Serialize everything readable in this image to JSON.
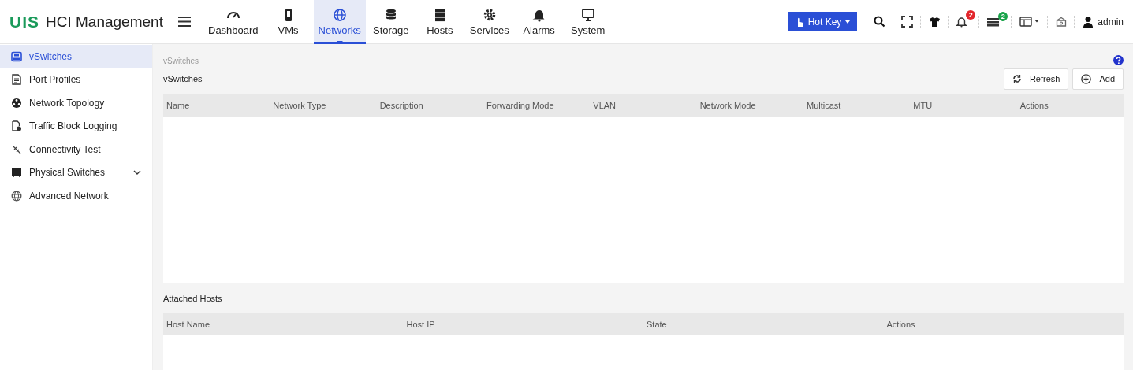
{
  "brand": {
    "logo": "UIS",
    "title": "HCI Management"
  },
  "nav": [
    {
      "label": "Dashboard",
      "selected": false
    },
    {
      "label": "VMs",
      "selected": false
    },
    {
      "label": "Networks",
      "selected": true
    },
    {
      "label": "Storage",
      "selected": false
    },
    {
      "label": "Hosts",
      "selected": false
    },
    {
      "label": "Services",
      "selected": false
    },
    {
      "label": "Alarms",
      "selected": false
    },
    {
      "label": "System",
      "selected": false
    }
  ],
  "hotkey": "Hot Key",
  "alarm_badge": "2",
  "task_badge": "2",
  "user": "admin",
  "sidebar": [
    {
      "label": "vSwitches",
      "selected": true
    },
    {
      "label": "Port Profiles",
      "selected": false
    },
    {
      "label": "Network Topology",
      "selected": false
    },
    {
      "label": "Traffic Block Logging",
      "selected": false
    },
    {
      "label": "Connectivity Test",
      "selected": false
    },
    {
      "label": "Physical Switches",
      "selected": false,
      "expanded": false
    },
    {
      "label": "Advanced Network",
      "selected": false
    }
  ],
  "breadcrumb": "vSwitches",
  "section_title": "vSwitches",
  "buttons": [
    "Refresh",
    "Add"
  ],
  "vswitch_table": {
    "columns": [
      "Name",
      "Network Type",
      "Description",
      "Forwarding Mode",
      "VLAN",
      "Network Mode",
      "Multicast",
      "MTU",
      "Actions"
    ]
  },
  "hosts_title": "Attached Hosts",
  "hosts_table": {
    "columns": [
      "Host Name",
      "Host IP",
      "State",
      "Actions"
    ]
  }
}
